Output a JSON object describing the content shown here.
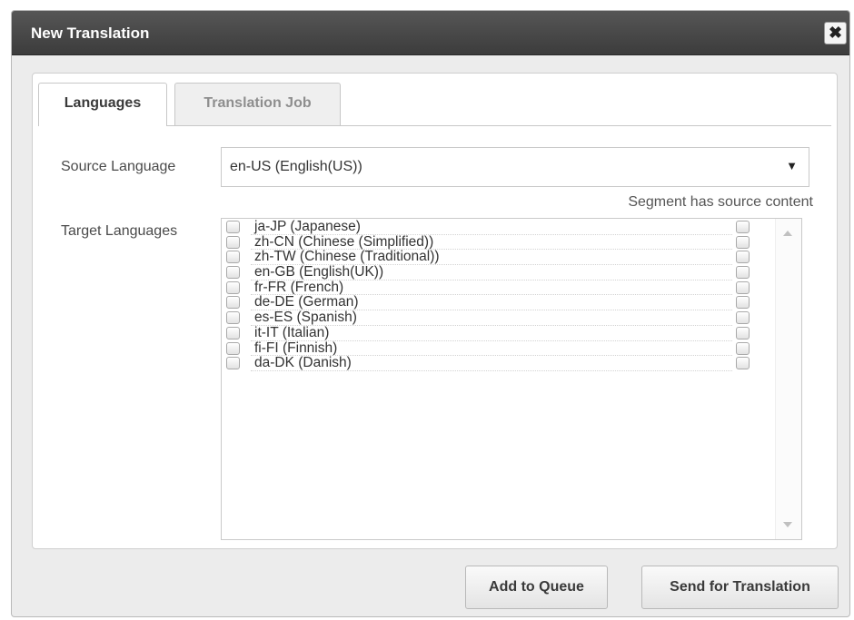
{
  "dialog": {
    "title": "New Translation",
    "close_glyph": "✖"
  },
  "tabs": [
    {
      "label": "Languages",
      "active": true
    },
    {
      "label": "Translation Job",
      "active": false
    }
  ],
  "source": {
    "label": "Source Language",
    "value": "en-US  (English(US))",
    "arrow_glyph": "▼"
  },
  "target": {
    "label": "Target Languages",
    "segment_header": "Segment has source content",
    "languages": [
      {
        "label": "ja-JP  (Japanese)",
        "checked": false,
        "segment_checked": false
      },
      {
        "label": "zh-CN  (Chinese (Simplified))",
        "checked": false,
        "segment_checked": false
      },
      {
        "label": "zh-TW  (Chinese (Traditional))",
        "checked": false,
        "segment_checked": false
      },
      {
        "label": "en-GB  (English(UK))",
        "checked": false,
        "segment_checked": false
      },
      {
        "label": "fr-FR  (French)",
        "checked": false,
        "segment_checked": false
      },
      {
        "label": "de-DE  (German)",
        "checked": false,
        "segment_checked": false
      },
      {
        "label": "es-ES  (Spanish)",
        "checked": false,
        "segment_checked": false
      },
      {
        "label": "it-IT  (Italian)",
        "checked": false,
        "segment_checked": false
      },
      {
        "label": "fi-FI  (Finnish)",
        "checked": false,
        "segment_checked": false
      },
      {
        "label": "da-DK  (Danish)",
        "checked": false,
        "segment_checked": false
      }
    ]
  },
  "buttons": {
    "add_to_queue": "Add to Queue",
    "send_for_translation": "Send for Translation"
  },
  "icons": {
    "close": "close-icon",
    "dropdown": "chevron-down-icon"
  },
  "colors": {
    "titlebar": "#444444",
    "dialog_bg": "#ececec"
  }
}
